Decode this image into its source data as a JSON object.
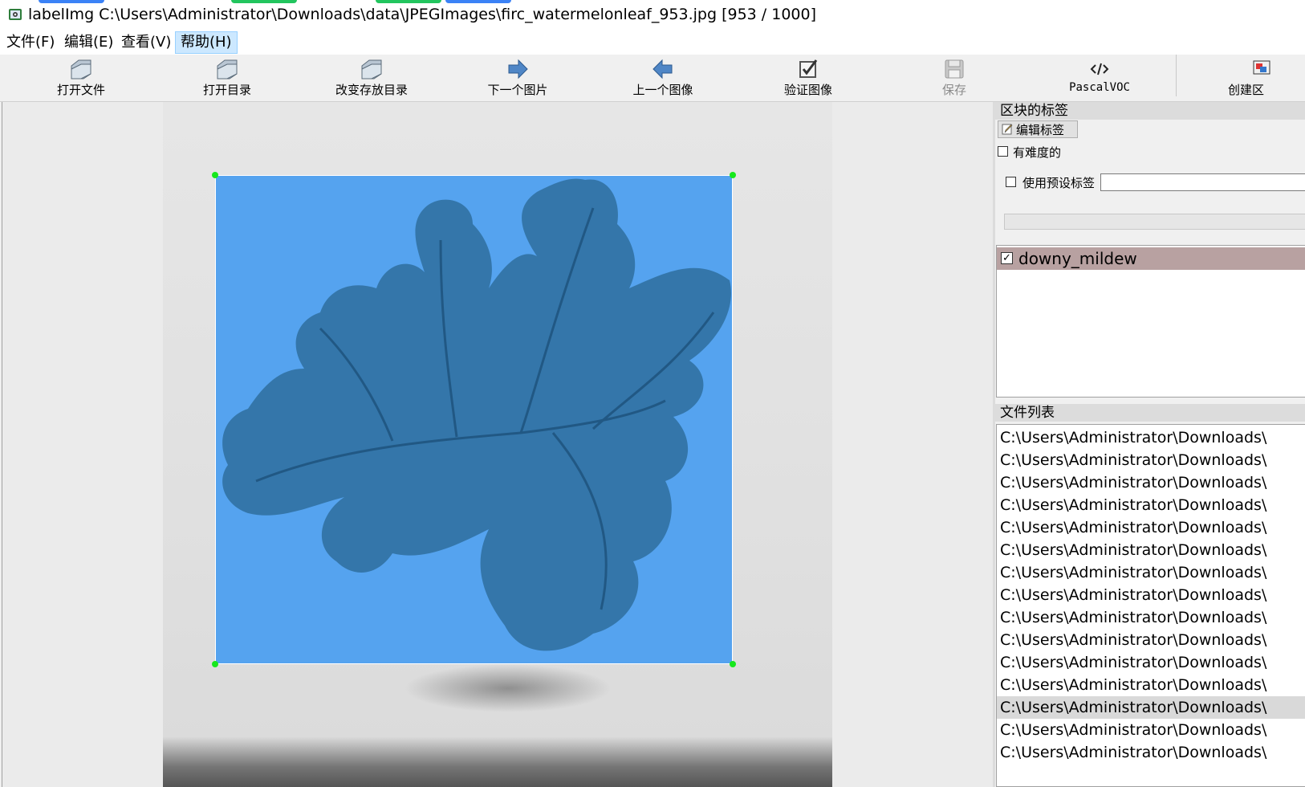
{
  "window": {
    "title": "labelImg C:\\Users\\Administrator\\Downloads\\data\\JPEGImages\\firc_watermelonleaf_953.jpg [953 / 1000]"
  },
  "menu": [
    {
      "label": "文件(F)"
    },
    {
      "label": "编辑(E)"
    },
    {
      "label": "查看(V)"
    },
    {
      "label": "帮助(H)"
    }
  ],
  "toolbar": {
    "open_file": "打开文件",
    "open_dir": "打开目录",
    "change_save_dir": "改变存放目录",
    "next_image": "下一个图片",
    "prev_image": "上一个图像",
    "verify_image": "验证图像",
    "save": "保存",
    "format": "PascalVOC",
    "create_box": "创建区"
  },
  "box_labels_panel": {
    "title": "区块的标签",
    "edit_label_button": "编辑标签",
    "difficult_label": "有难度的",
    "use_default_label": "使用预设标签",
    "labels": [
      {
        "name": "downy_mildew",
        "checked": true
      }
    ]
  },
  "file_list_panel": {
    "title": "文件列表",
    "files": [
      "C:\\Users\\Administrator\\Downloads\\",
      "C:\\Users\\Administrator\\Downloads\\",
      "C:\\Users\\Administrator\\Downloads\\",
      "C:\\Users\\Administrator\\Downloads\\",
      "C:\\Users\\Administrator\\Downloads\\",
      "C:\\Users\\Administrator\\Downloads\\",
      "C:\\Users\\Administrator\\Downloads\\",
      "C:\\Users\\Administrator\\Downloads\\",
      "C:\\Users\\Administrator\\Downloads\\",
      "C:\\Users\\Administrator\\Downloads\\",
      "C:\\Users\\Administrator\\Downloads\\",
      "C:\\Users\\Administrator\\Downloads\\",
      "C:\\Users\\Administrator\\Downloads\\",
      "C:\\Users\\Administrator\\Downloads\\",
      "C:\\Users\\Administrator\\Downloads\\"
    ],
    "selected_index": 12
  },
  "colors": {
    "bbox_fill": "#55a3ef",
    "bbox_handle": "#16e81c",
    "label_row_bg": "#b8a1a1",
    "menu_active_bg": "#cce8ff"
  }
}
